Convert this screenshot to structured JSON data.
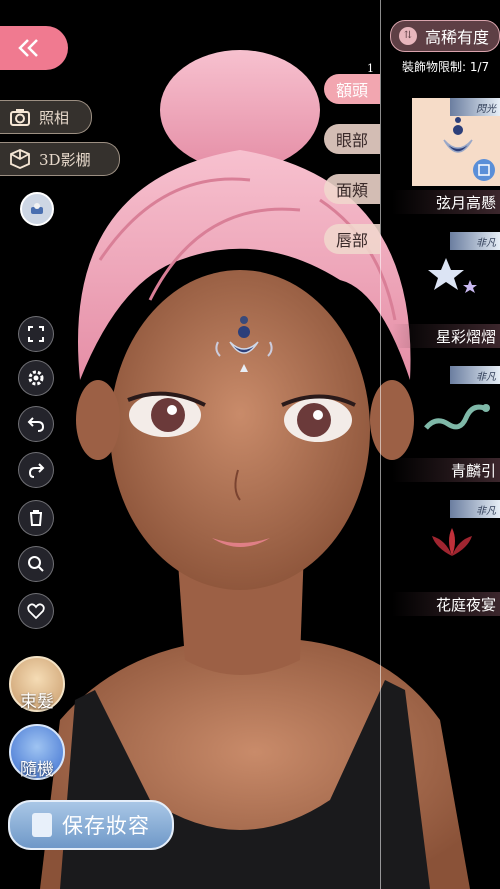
{
  "left_panel": {
    "photo_label": "照相",
    "studio_label": "3D影棚",
    "hair_tie_label": "束髮",
    "random_label": "隨機",
    "save_label": "保存妝容"
  },
  "categories": [
    {
      "label": "額頭",
      "badge": "1"
    },
    {
      "label": "眼部"
    },
    {
      "label": "面頰"
    },
    {
      "label": "唇部"
    }
  ],
  "sort": {
    "label": "高稀有度"
  },
  "limit_text": "裝飾物限制: 1/7",
  "items": [
    {
      "name": "弦月高懸",
      "ribbon": "閃光",
      "selected": true
    },
    {
      "name": "星彩熠熠",
      "ribbon": "非凡"
    },
    {
      "name": "青麟引",
      "ribbon": "非凡"
    },
    {
      "name": "花庭夜宴",
      "ribbon": "非凡"
    }
  ],
  "colors": {
    "accent_pink": "#f07a90",
    "hair_pink": "#f3a3b8",
    "panel_brown": "#5e3f45",
    "save_blue": "#7fa6d2"
  }
}
